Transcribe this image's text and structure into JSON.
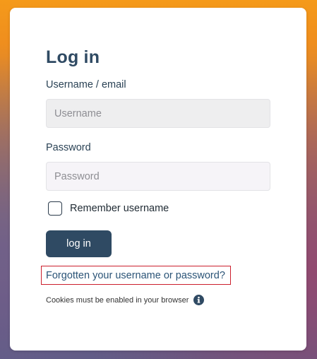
{
  "login": {
    "title": "Log in",
    "username_label": "Username / email",
    "username_placeholder": "Username",
    "username_value": "",
    "password_label": "Password",
    "password_placeholder": "Password",
    "password_value": "",
    "remember_label": "Remember username",
    "remember_checked": false,
    "login_button": "log in",
    "forgot_link": "Forgotten your username or password?",
    "cookies_notice": "Cookies must be enabled in your browser",
    "info_icon": "info-circle-icon"
  },
  "colors": {
    "primary": "#2f4a63",
    "link": "#2b5477",
    "highlight_border": "#cc1f2d",
    "background_top": "#f59a1a",
    "background_bottom": "#5c5b85"
  }
}
